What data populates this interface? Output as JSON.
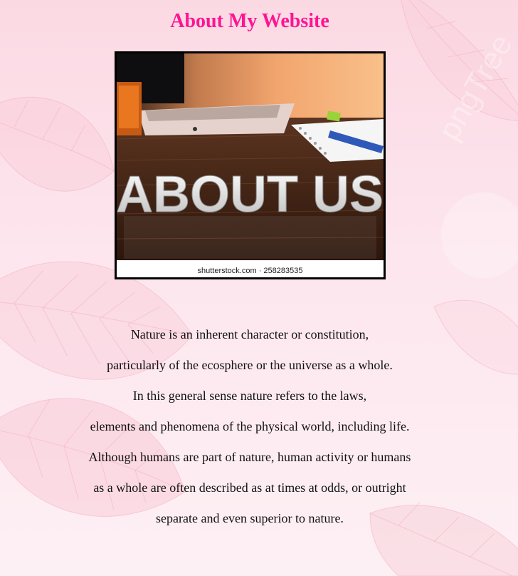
{
  "page": {
    "title": "About My Website",
    "title_color": "#ff1493",
    "background_color": "#fde6ee"
  },
  "hero_image": {
    "overlay_text": "ABOUT US",
    "caption": "shutterstock.com · 258283535",
    "watermark": "pngTree"
  },
  "body_lines": [
    "Nature is an inherent character or constitution,",
    "particularly of the ecosphere or the universe as a whole.",
    "In this general sense nature refers to the laws,",
    "elements and phenomena of the physical world, including life.",
    "Although humans are part of nature, human activity or humans",
    "as a whole are often described as at times at odds, or outright",
    "separate and even superior to nature."
  ]
}
